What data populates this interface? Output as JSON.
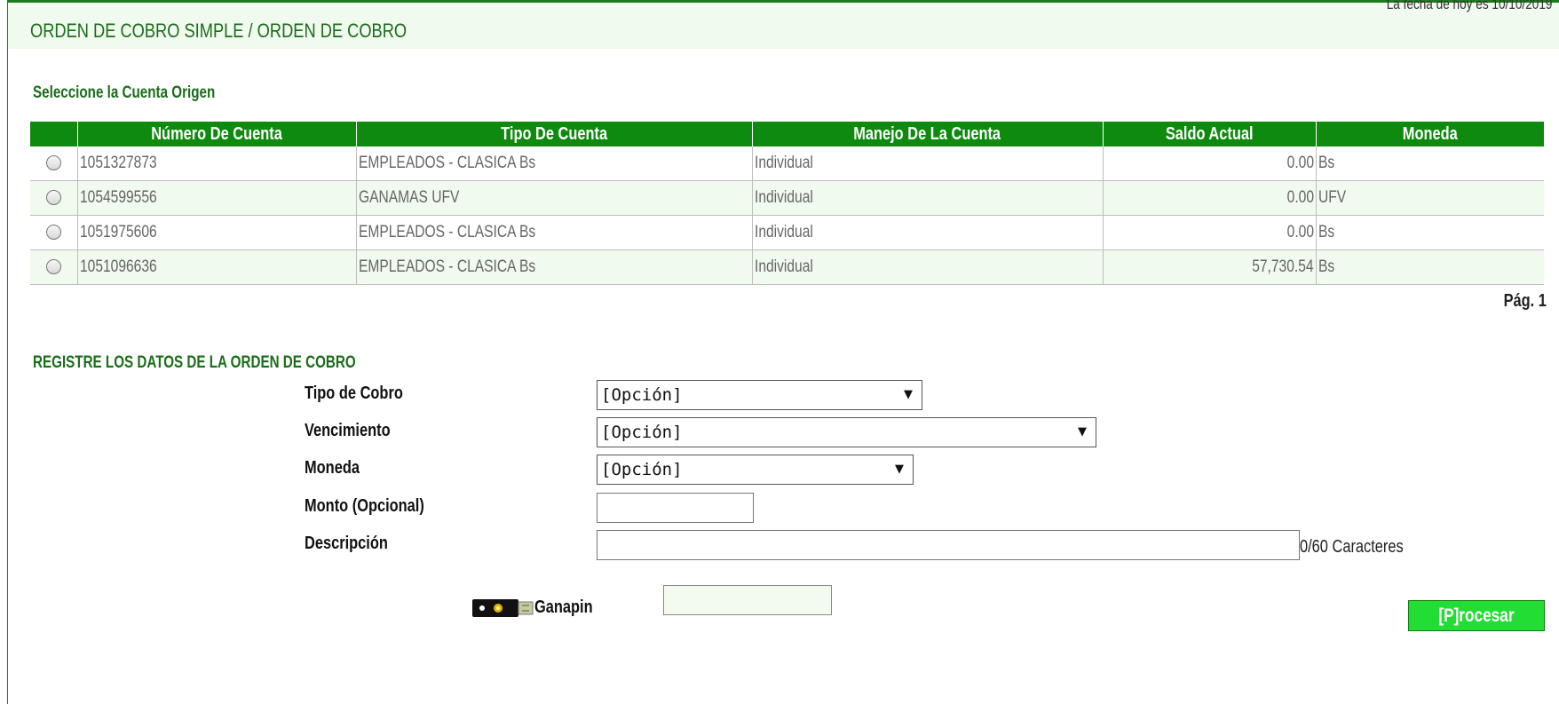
{
  "header": {
    "title": "ORDEN DE COBRO SIMPLE / ORDEN DE COBRO",
    "date_partial": "La fecha de hoy es 10/10/2019"
  },
  "accounts": {
    "section_label": "Seleccione la Cuenta Origen",
    "columns": [
      "Número De Cuenta",
      "Tipo De Cuenta",
      "Manejo De La Cuenta",
      "Saldo Actual",
      "Moneda"
    ],
    "rows": [
      {
        "numero": "1051327873",
        "tipo": "EMPLEADOS - CLASICA Bs",
        "manejo": "Individual",
        "saldo": "0.00",
        "moneda": "Bs"
      },
      {
        "numero": "1054599556",
        "tipo": "GANAMAS UFV",
        "manejo": "Individual",
        "saldo": "0.00",
        "moneda": "UFV"
      },
      {
        "numero": "1051975606",
        "tipo": "EMPLEADOS - CLASICA Bs",
        "manejo": "Individual",
        "saldo": "0.00",
        "moneda": "Bs"
      },
      {
        "numero": "1051096636",
        "tipo": "EMPLEADOS - CLASICA Bs",
        "manejo": "Individual",
        "saldo": "57,730.54",
        "moneda": "Bs"
      }
    ],
    "pagination": "Pág. 1"
  },
  "form": {
    "section_label": "REGISTRE LOS DATOS DE LA ORDEN DE COBRO",
    "tipo_cobro": {
      "label": "Tipo de Cobro",
      "value": "[Opción]"
    },
    "vencimiento": {
      "label": "Vencimiento",
      "value": "[Opción]"
    },
    "moneda": {
      "label": "Moneda",
      "value": "[Opción]"
    },
    "monto": {
      "label": "Monto (Opcional)",
      "value": ""
    },
    "descripcion": {
      "label": "Descripción",
      "value": "",
      "counter": "0/60 Caracteres"
    },
    "ganapin": {
      "label": "Ganapin",
      "value": ""
    },
    "submit_label": "[P]rocesar"
  },
  "colors": {
    "header_green": "#0e8a0e",
    "title_green": "#1a6d1a",
    "band_bg": "#f1faee",
    "button_green": "#22dd33"
  }
}
